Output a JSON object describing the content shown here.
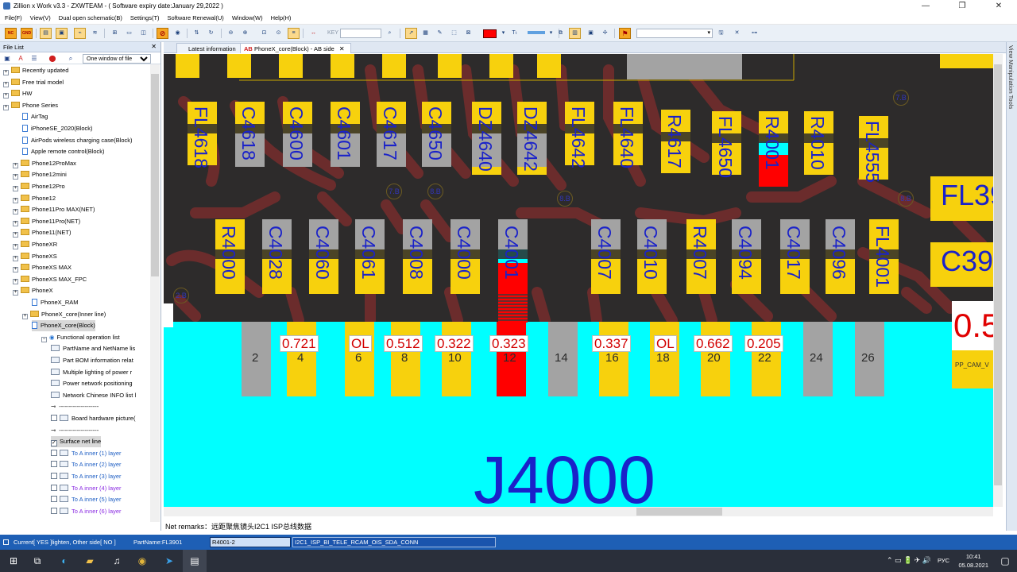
{
  "window": {
    "title": "Zillion x Work v3.3 - ZXWTEAM - ( Software expiry date:January 29,2022 )",
    "controls": [
      "—",
      "❐",
      "✕"
    ]
  },
  "menu": [
    "File(F)",
    "View(V)",
    "Dual open schematic(B)",
    "Settings(T)",
    "Software Renewal(U)",
    "Window(W)",
    "Help(H)"
  ],
  "toolbar": {
    "nc_label": "NC",
    "gnd_label": "GND",
    "key_label": "KEY",
    "color_accent": "#f5a623"
  },
  "file_list": {
    "title": "File List",
    "close": "✕",
    "window_mode": "One window of file",
    "items": [
      {
        "label": "Recently updated",
        "type": "folder"
      },
      {
        "label": "Free trial model",
        "type": "folder"
      },
      {
        "label": "HW",
        "type": "folder"
      },
      {
        "label": "Phone Series",
        "type": "folder"
      },
      {
        "label": "AirTag",
        "type": "doc"
      },
      {
        "label": "iPhoneSE_2020(Block)",
        "type": "doc"
      },
      {
        "label": "AirPods wireless charging case(Block)",
        "type": "doc"
      },
      {
        "label": "Apple remote control(Block)",
        "type": "doc"
      },
      {
        "label": "Phone12ProMax",
        "type": "folder"
      },
      {
        "label": "Phone12mini",
        "type": "folder"
      },
      {
        "label": "Phone12Pro",
        "type": "folder"
      },
      {
        "label": "Phone12",
        "type": "folder"
      },
      {
        "label": "Phone11Pro MAX(NET)",
        "type": "folder"
      },
      {
        "label": "Phone11Pro(NET)",
        "type": "folder"
      },
      {
        "label": "Phone11(NET)",
        "type": "folder"
      },
      {
        "label": "PhoneXR",
        "type": "folder"
      },
      {
        "label": "PhoneXS",
        "type": "folder"
      },
      {
        "label": "PhoneXS MAX",
        "type": "folder"
      },
      {
        "label": "PhoneXS MAX_FPC",
        "type": "folder"
      },
      {
        "label": "PhoneX",
        "type": "folder"
      },
      {
        "label": "PhoneX_RAM",
        "type": "doc"
      },
      {
        "label": "PhoneX_core(Inner line)",
        "type": "folder"
      },
      {
        "label": "PhoneX_core(Block)",
        "type": "doc"
      },
      {
        "label": "Functional operation list",
        "type": "func"
      },
      {
        "label": "PartName and NetName lis",
        "type": "list"
      },
      {
        "label": "Part BOM information relat",
        "type": "list"
      },
      {
        "label": "Multiple lighting of power r",
        "type": "list"
      },
      {
        "label": "Power network positioning",
        "type": "list"
      },
      {
        "label": "Network Chinese INFO list l",
        "type": "list"
      },
      {
        "label": "--------------------",
        "type": "sep"
      },
      {
        "label": "Board hardware picture(",
        "type": "check"
      },
      {
        "label": "--------------------",
        "type": "sep"
      },
      {
        "label": "Surface net line",
        "type": "checked"
      },
      {
        "label": "To A inner (1) layer",
        "type": "layer"
      },
      {
        "label": "To A inner (2) layer",
        "type": "layer"
      },
      {
        "label": "To A inner (3) layer",
        "type": "layer"
      },
      {
        "label": "To A inner (4) layer",
        "type": "layer"
      },
      {
        "label": "To A inner (5) layer",
        "type": "layer"
      },
      {
        "label": "To A inner (6) layer",
        "type": "layer"
      }
    ]
  },
  "tabs": [
    {
      "label": "Latest information"
    },
    {
      "label": "PhoneX_core(Block) - AB side",
      "prefix": "AB",
      "close": "✕"
    }
  ],
  "board": {
    "row1": [
      "FL4618",
      "C4618",
      "C4600",
      "C4601",
      "C4617",
      "C4650",
      "DZ4640",
      "DZ4642",
      "FL4642",
      "FL4640",
      "R4617",
      "FL4650",
      "R4001",
      "R4010",
      "FL4555"
    ],
    "row1_right": "FL39",
    "row2": [
      "R4000",
      "C4028",
      "C4060",
      "C4061",
      "C4008",
      "C4000",
      "C4001",
      "C4007",
      "C4010",
      "R4007",
      "C4094",
      "C4017",
      "C4096",
      "FL4001"
    ],
    "row2_right": "C39",
    "vias": [
      "7.B",
      "7.B",
      "8.B",
      "8.B",
      "8.B",
      "2.B",
      "7.B"
    ],
    "pin_numbers": [
      "2",
      "4",
      "6",
      "8",
      "10",
      "12",
      "14",
      "16",
      "18",
      "20",
      "22",
      "24",
      "26"
    ],
    "pin_values": [
      "0.721",
      "OL",
      "0.512",
      "0.322",
      "0.323",
      "0.337",
      "OL",
      "0.662",
      "0.205"
    ],
    "right_value": "0.5",
    "right_net": "PP_CAM_V",
    "connector": "J4000",
    "colors": {
      "board": "#2d2b2b",
      "trace": "#6b2c2c",
      "pad": "#f7d10d",
      "connector": "#00ffff",
      "highlight": "#ff0000"
    }
  },
  "remarks": {
    "text": "Net remarks：远距聚焦镜头I2C1 ISP总线数据"
  },
  "status": {
    "current": "Current[ YES ]lighten, Other side[ NO ]",
    "partname": "PartName:FL3901",
    "part_pin": "R4001-2",
    "net": "I2C1_ISP_BI_TELE_RCAM_OIS_SDA_CONN"
  },
  "taskbar": {
    "tray_lang": "РУС",
    "time": "10:41",
    "date": "05.08.2021"
  }
}
